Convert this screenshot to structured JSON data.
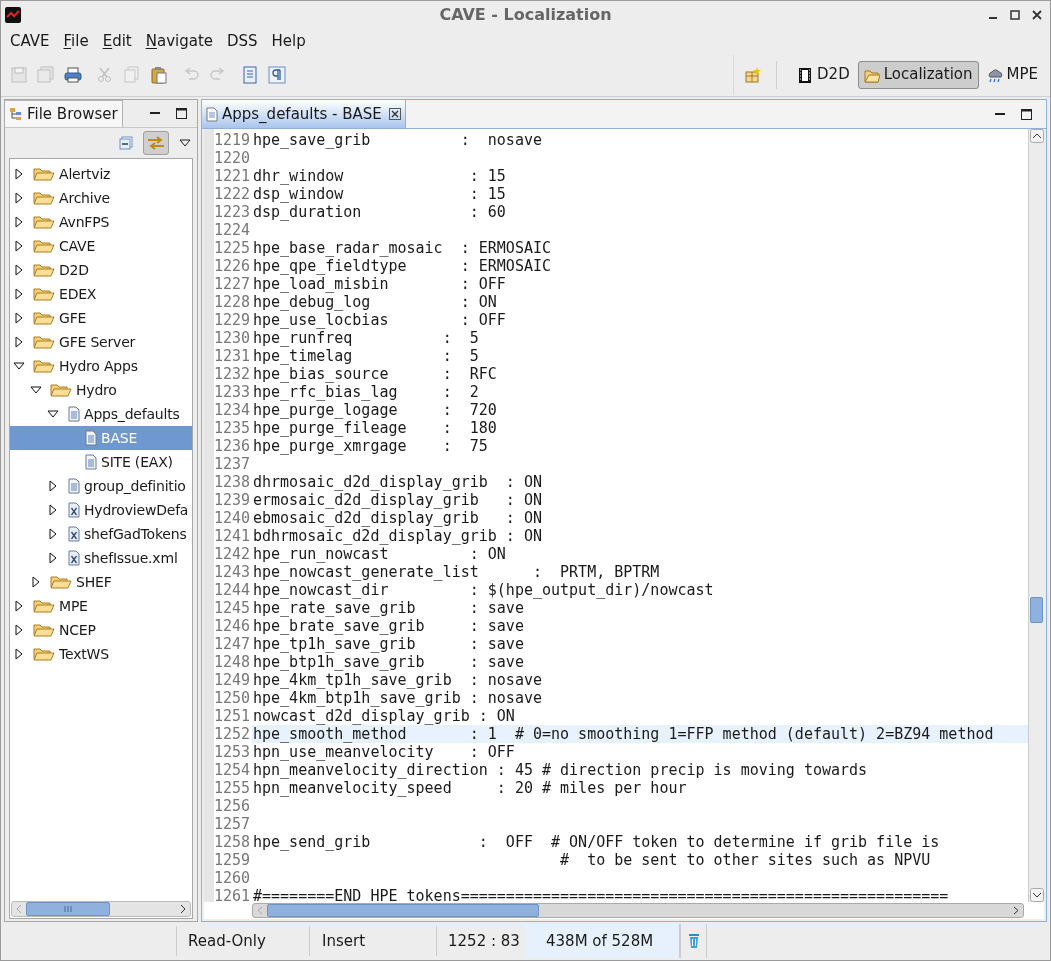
{
  "window": {
    "title": "CAVE - Localization"
  },
  "menu": [
    {
      "label": "CAVE",
      "underlined": false
    },
    {
      "label": "File",
      "underlined": true
    },
    {
      "label": "Edit",
      "underlined": true
    },
    {
      "label": "Navigate",
      "underlined": true
    },
    {
      "label": "DSS",
      "underlined": false
    },
    {
      "label": "Help",
      "underlined": false
    }
  ],
  "toolbar": [
    {
      "kind": "save",
      "disabled": true
    },
    {
      "kind": "save-all",
      "disabled": true
    },
    {
      "kind": "print",
      "disabled": false
    },
    {
      "kind": "cut",
      "disabled": true
    },
    {
      "kind": "copy",
      "disabled": true
    },
    {
      "kind": "paste",
      "disabled": false
    },
    {
      "kind": "undo",
      "disabled": true
    },
    {
      "kind": "redo",
      "disabled": true
    },
    {
      "kind": "document",
      "disabled": false
    },
    {
      "kind": "pilcrow",
      "disabled": false
    }
  ],
  "perspectives": [
    {
      "label": "D2D",
      "kind": "film",
      "selected": false
    },
    {
      "label": "Localization",
      "kind": "folder",
      "selected": true
    },
    {
      "label": "MPE",
      "kind": "cloud",
      "selected": false
    }
  ],
  "file_browser": {
    "title": "File Browser",
    "tree": [
      {
        "label": "Alertviz",
        "kind": "folder",
        "expanded": false,
        "selected": false
      },
      {
        "label": "Archive",
        "kind": "folder",
        "expanded": false,
        "selected": false
      },
      {
        "label": "AvnFPS",
        "kind": "folder",
        "expanded": false,
        "selected": false
      },
      {
        "label": "CAVE",
        "kind": "folder",
        "expanded": false,
        "selected": false
      },
      {
        "label": "D2D",
        "kind": "folder",
        "expanded": false,
        "selected": false
      },
      {
        "label": "EDEX",
        "kind": "folder",
        "expanded": false,
        "selected": false
      },
      {
        "label": "GFE",
        "kind": "folder",
        "expanded": false,
        "selected": false
      },
      {
        "label": "GFE Server",
        "kind": "folder",
        "expanded": false,
        "selected": false
      },
      {
        "label": "Hydro Apps",
        "kind": "folder",
        "expanded": true,
        "selected": false,
        "children": [
          {
            "label": "Hydro",
            "kind": "folder",
            "expanded": true,
            "selected": false,
            "children": [
              {
                "label": "Apps_defaults",
                "kind": "file",
                "expanded": true,
                "selected": false,
                "children": [
                  {
                    "label": "BASE",
                    "kind": "file",
                    "selected": true
                  },
                  {
                    "label": "SITE (EAX)",
                    "kind": "file",
                    "selected": false
                  }
                ]
              },
              {
                "label": "group_definitio",
                "kind": "file",
                "expanded": false,
                "selected": false
              },
              {
                "label": "HydroviewDefa",
                "kind": "xml",
                "expanded": false,
                "selected": false
              },
              {
                "label": "shefGadTokens",
                "kind": "xml",
                "expanded": false,
                "selected": false
              },
              {
                "label": "shefIssue.xml",
                "kind": "xml",
                "expanded": false,
                "selected": false
              }
            ]
          },
          {
            "label": "SHEF",
            "kind": "folder",
            "expanded": false,
            "selected": false
          }
        ]
      },
      {
        "label": "MPE",
        "kind": "folder",
        "expanded": false,
        "selected": false
      },
      {
        "label": "NCEP",
        "kind": "folder",
        "expanded": false,
        "selected": false
      },
      {
        "label": "TextWS",
        "kind": "folder",
        "expanded": false,
        "selected": false
      }
    ]
  },
  "editor": {
    "tab": "Apps_defaults - BASE",
    "lines": [
      {
        "number": "1219",
        "text": "hpe_save_grib          :  nosave",
        "current": false
      },
      {
        "number": "1220",
        "current": false
      },
      {
        "number": "1221",
        "text": "dhr_window              : 15",
        "current": false
      },
      {
        "number": "1222",
        "text": "dsp_window              : 15",
        "current": false
      },
      {
        "number": "1223",
        "text": "dsp_duration            : 60",
        "current": false
      },
      {
        "number": "1224",
        "current": false
      },
      {
        "number": "1225",
        "text": "hpe_base_radar_mosaic  : ERMOSAIC",
        "current": false
      },
      {
        "number": "1226",
        "text": "hpe_qpe_fieldtype      : ERMOSAIC",
        "current": false
      },
      {
        "number": "1227",
        "text": "hpe_load_misbin        : OFF",
        "current": false
      },
      {
        "number": "1228",
        "text": "hpe_debug_log          : ON",
        "current": false
      },
      {
        "number": "1229",
        "text": "hpe_use_locbias        : OFF",
        "current": false
      },
      {
        "number": "1230",
        "text": "hpe_runfreq          :  5",
        "current": false
      },
      {
        "number": "1231",
        "text": "hpe_timelag          :  5",
        "current": false
      },
      {
        "number": "1232",
        "text": "hpe_bias_source      :  RFC",
        "current": false
      },
      {
        "number": "1233",
        "text": "hpe_rfc_bias_lag     :  2",
        "current": false
      },
      {
        "number": "1234",
        "text": "hpe_purge_logage     :  720",
        "current": false
      },
      {
        "number": "1235",
        "text": "hpe_purge_fileage    :  180",
        "current": false
      },
      {
        "number": "1236",
        "text": "hpe_purge_xmrgage    :  75",
        "current": false
      },
      {
        "number": "1237",
        "current": false
      },
      {
        "number": "1238",
        "text": "dhrmosaic_d2d_display_grib  : ON",
        "current": false
      },
      {
        "number": "1239",
        "text": "ermosaic_d2d_display_grib   : ON",
        "current": false
      },
      {
        "number": "1240",
        "text": "ebmosaic_d2d_display_grib   : ON",
        "current": false
      },
      {
        "number": "1241",
        "text": "bdhrmosaic_d2d_display_grib : ON",
        "current": false
      },
      {
        "number": "1242",
        "text": "hpe_run_nowcast         : ON",
        "current": false
      },
      {
        "number": "1243",
        "text": "hpe_nowcast_generate_list      :  PRTM, BPTRM",
        "current": false
      },
      {
        "number": "1244",
        "text": "hpe_nowcast_dir         : $(hpe_output_dir)/nowcast",
        "current": false
      },
      {
        "number": "1245",
        "text": "hpe_rate_save_grib      : save",
        "current": false
      },
      {
        "number": "1246",
        "text": "hpe_brate_save_grib     : save",
        "current": false
      },
      {
        "number": "1247",
        "text": "hpe_tp1h_save_grib      : save",
        "current": false
      },
      {
        "number": "1248",
        "text": "hpe_btp1h_save_grib     : save",
        "current": false
      },
      {
        "number": "1249",
        "text": "hpe_4km_tp1h_save_grib  : nosave",
        "current": false
      },
      {
        "number": "1250",
        "text": "hpe_4km_btp1h_save_grib : nosave",
        "current": false
      },
      {
        "number": "1251",
        "text": "nowcast_d2d_display_grib : ON",
        "current": false
      },
      {
        "number": "1252",
        "text": "hpe_smooth_method       : 1  # 0=no smoothing 1=FFP method (default) 2=BZ94 method",
        "current": true
      },
      {
        "number": "1253",
        "text": "hpn_use_meanvelocity    : OFF",
        "current": false
      },
      {
        "number": "1254",
        "text": "hpn_meanvelocity_direction : 45 # direction precip is moving towards",
        "current": false
      },
      {
        "number": "1255",
        "text": "hpn_meanvelocity_speed     : 20 # miles per hour",
        "current": false
      },
      {
        "number": "1256",
        "current": false
      },
      {
        "number": "1257",
        "current": false
      },
      {
        "number": "1258",
        "text": "hpe_send_grib            :  OFF  # ON/OFF token to determine if grib file is",
        "current": false
      },
      {
        "number": "1259",
        "text": "                                  #  to be sent to other sites such as NPVU",
        "current": false
      },
      {
        "number": "1260",
        "current": false
      },
      {
        "number": "1261",
        "text": "#========END HPE tokens======================================================",
        "current": false
      }
    ]
  },
  "status_bar": {
    "mode": "Read-Only",
    "insert": "Insert",
    "position": "1252 : 83",
    "memory": "438M of 528M"
  }
}
